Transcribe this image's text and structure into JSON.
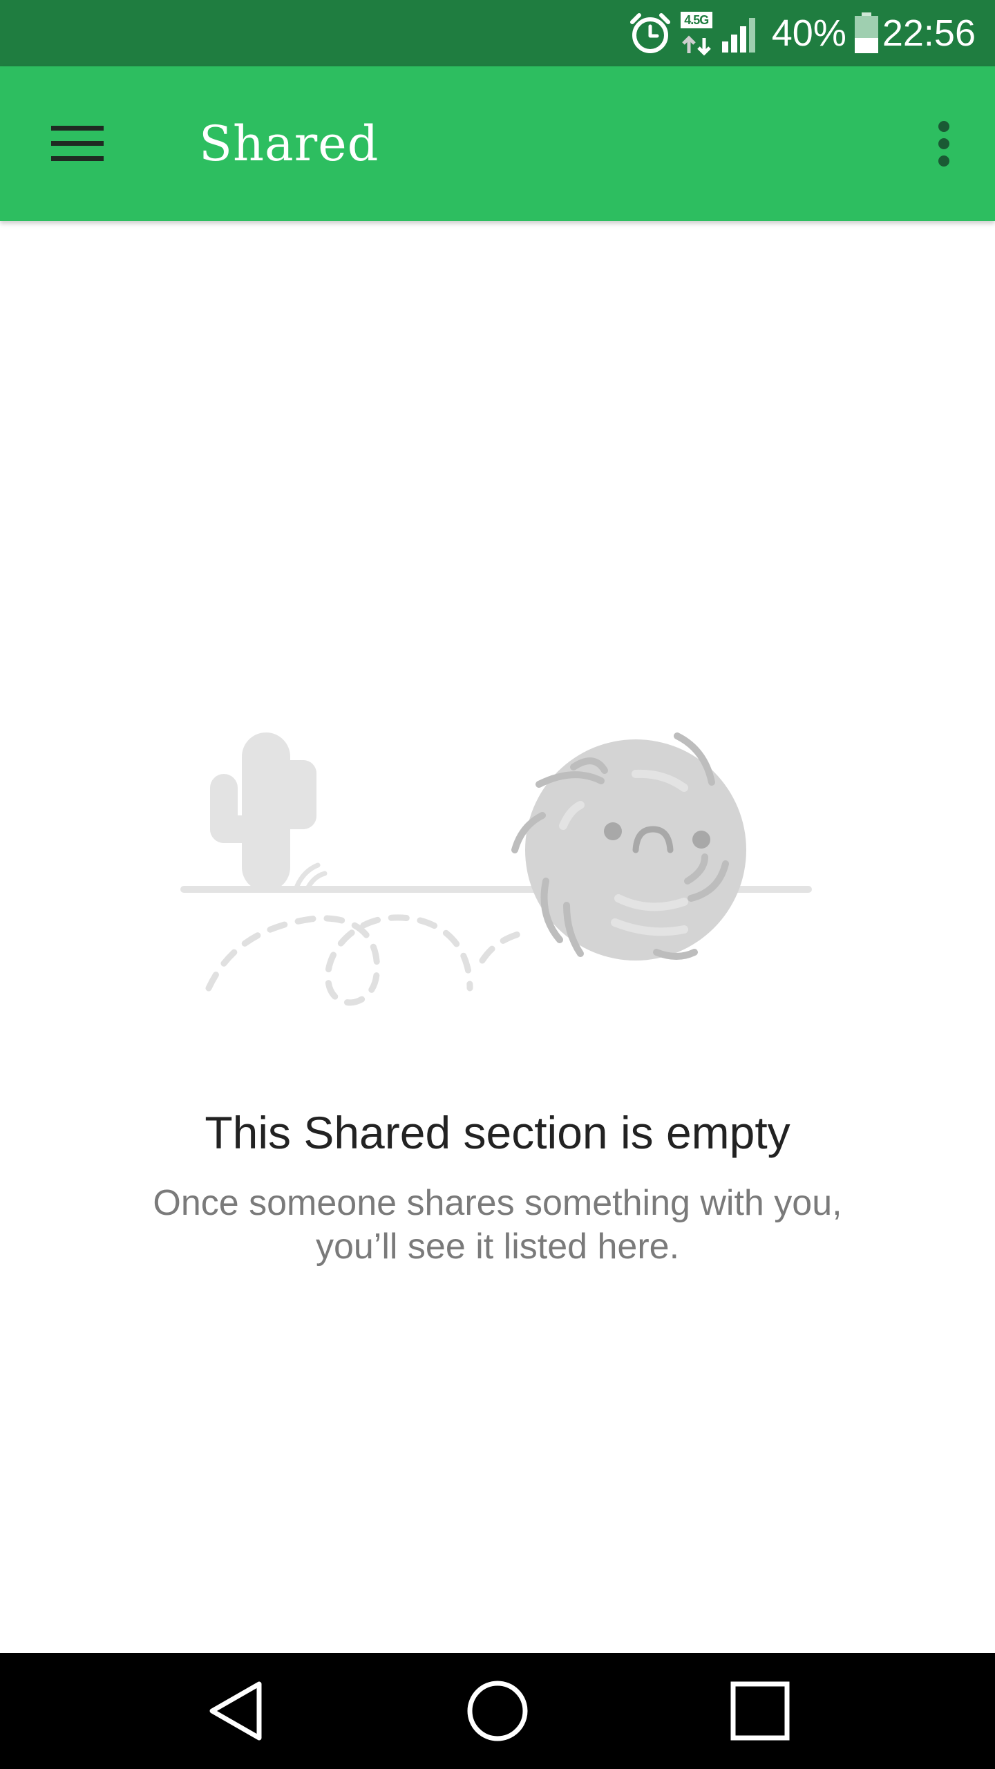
{
  "status_bar": {
    "network_label": "4.5G",
    "battery_percent": "40%",
    "time": "22:56",
    "battery_level": 0.4,
    "icons": [
      "alarm-icon",
      "data-transfer-icon",
      "signal-icon",
      "battery-icon"
    ]
  },
  "app_bar": {
    "title": "Shared",
    "menu_icon": "hamburger-menu-icon",
    "overflow_icon": "more-vert-icon",
    "color": "#2dbe60"
  },
  "empty_state": {
    "title": "This Shared section is empty",
    "message": "Once someone shares something with you, you’ll see it listed here.",
    "illustration": "desert-tumbleweed-illustration"
  },
  "nav_bar": {
    "icons": [
      "back-icon",
      "home-icon",
      "recents-icon"
    ]
  },
  "colors": {
    "status_bar": "#1f7d40",
    "accent": "#2dbe60",
    "title_text": "#222222",
    "message_text": "#7a7a7a"
  }
}
